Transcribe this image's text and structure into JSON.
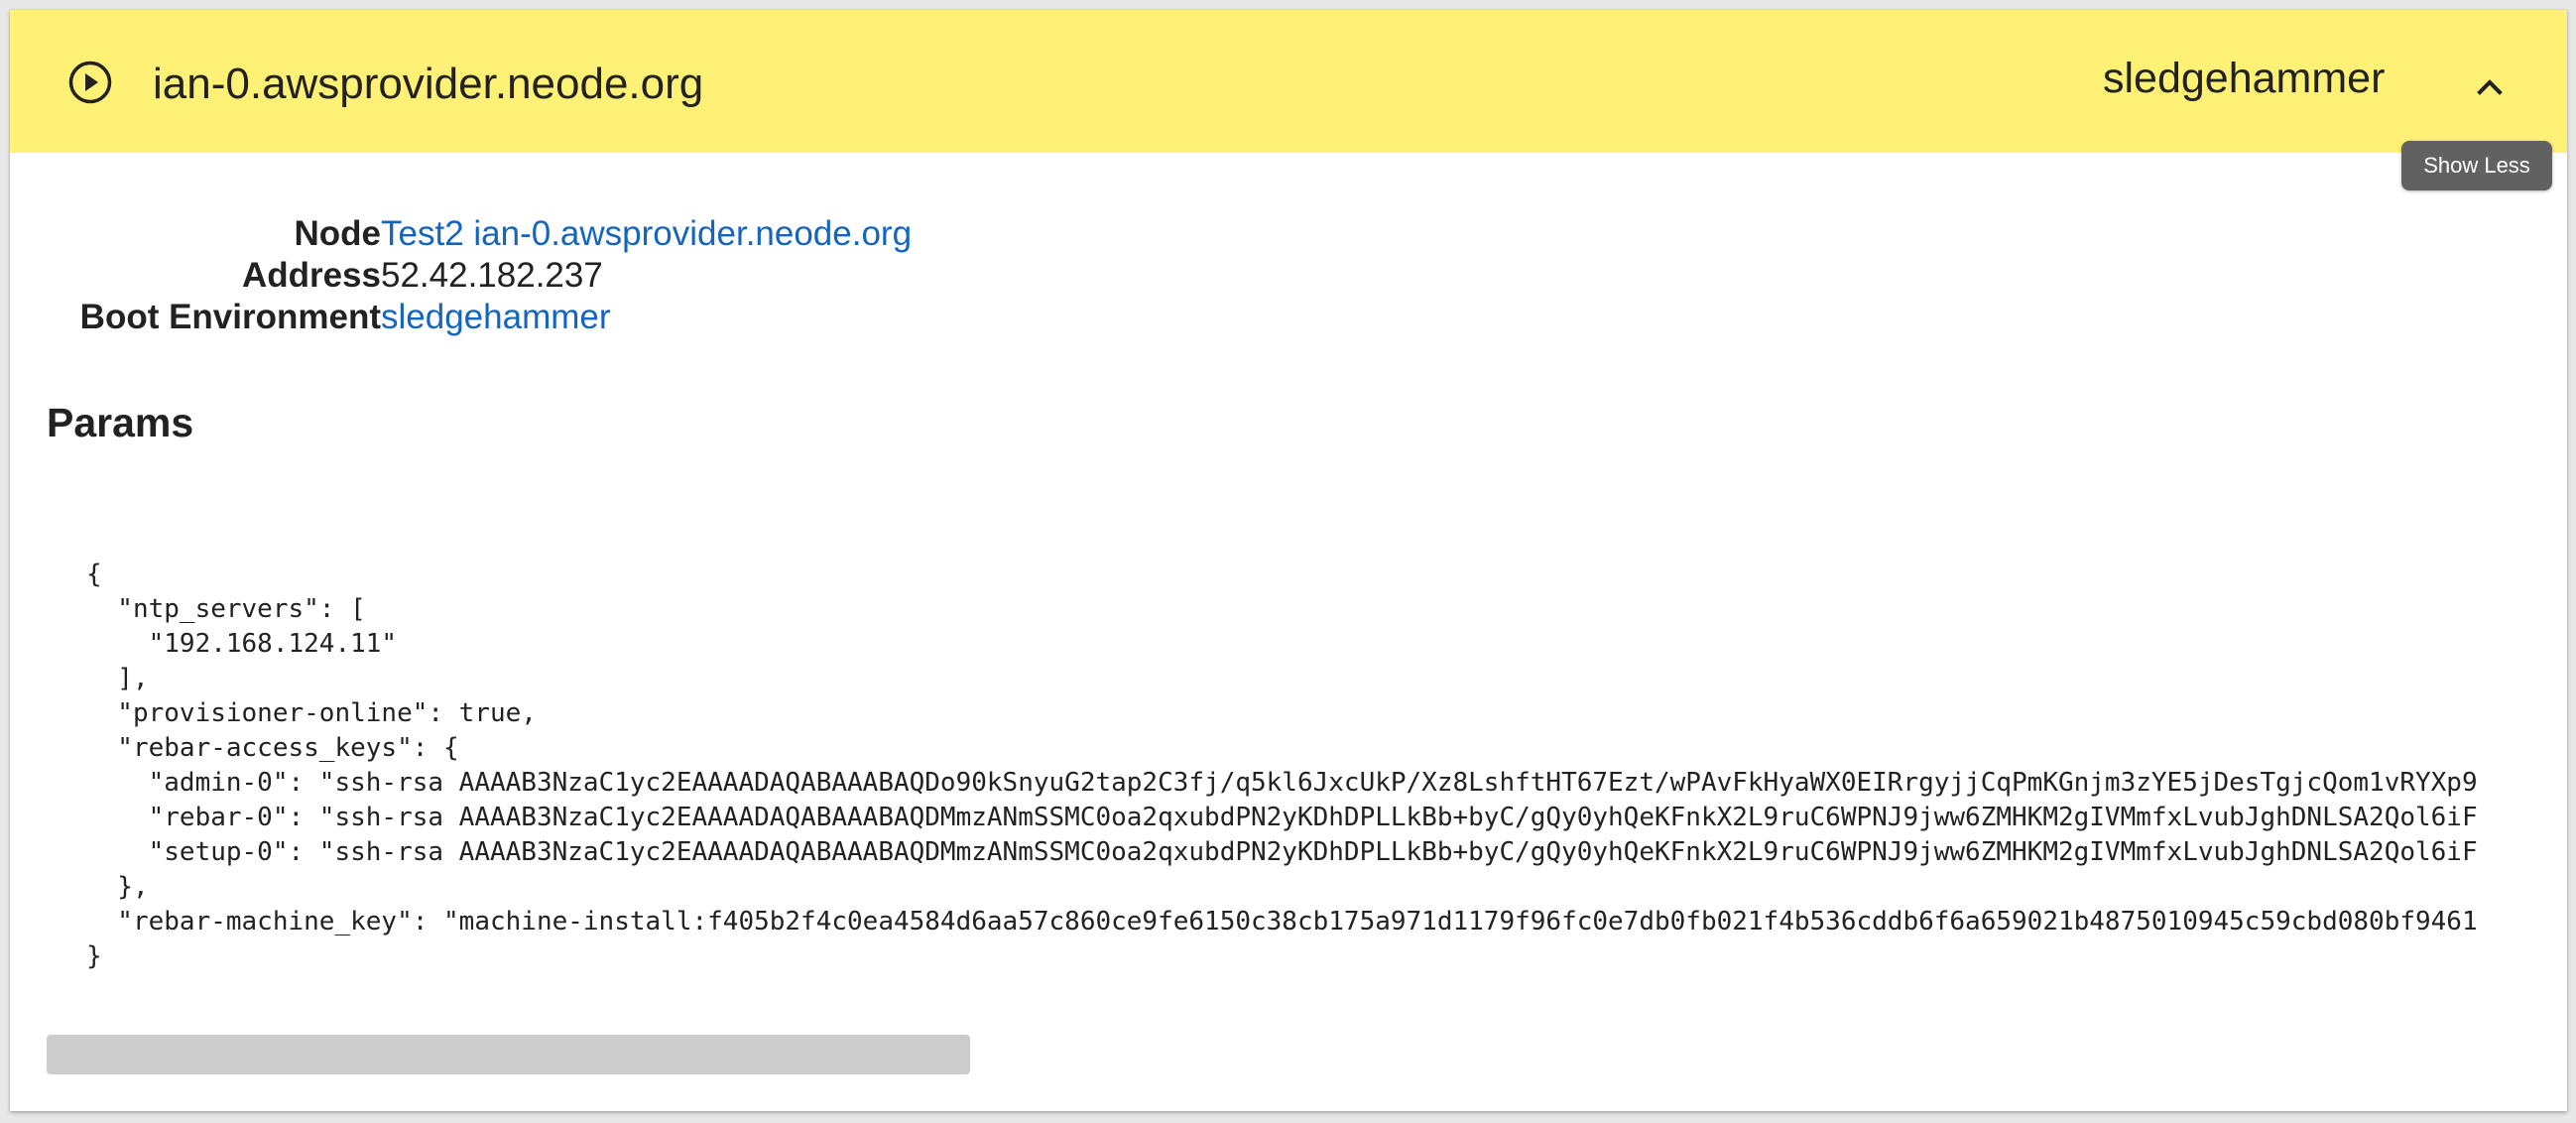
{
  "header": {
    "play_icon": "play-circle-icon",
    "machine_name": "ian-0.awsprovider.neode.org",
    "boot_env": "sledgehammer",
    "collapse_icon": "chevron-up-icon",
    "background_color": "#fff176"
  },
  "tooltip": {
    "text": "Show Less"
  },
  "details": {
    "node": {
      "label": "Node",
      "value": "Test2 ian-0.awsprovider.neode.org"
    },
    "address": {
      "label": "Address",
      "value": "52.42.182.237"
    },
    "boot_environment": {
      "label": "Boot Environment",
      "value": "sledgehammer"
    },
    "link_color": "#1565c0"
  },
  "params": {
    "title": "Params",
    "json_text": "{\n  \"ntp_servers\": [\n    \"192.168.124.11\"\n  ],\n  \"provisioner-online\": true,\n  \"rebar-access_keys\": {\n    \"admin-0\": \"ssh-rsa AAAAB3NzaC1yc2EAAAADAQABAAABAQDo90kSnyuG2tap2C3fj/q5kl6JxcUkP/Xz8LshftHT67Ezt/wPAvFkHyaWX0EIRrgyjjCqPmKGnjm3zYE5jDesTgjcQom1vRYXp9\n    \"rebar-0\": \"ssh-rsa AAAAB3NzaC1yc2EAAAADAQABAAABAQDMmzANmSSMC0oa2qxubdPN2yKDhDPLLkBb+byC/gQy0yhQeKFnkX2L9ruC6WPNJ9jww6ZMHKM2gIVMmfxLvubJghDNLSA2Qol6iF\n    \"setup-0\": \"ssh-rsa AAAAB3NzaC1yc2EAAAADAQABAAABAQDMmzANmSSMC0oa2qxubdPN2yKDhDPLLkBb+byC/gQy0yhQeKFnkX2L9ruC6WPNJ9jww6ZMHKM2gIVMmfxLvubJghDNLSA2Qol6iF\n  },\n  \"rebar-machine_key\": \"machine-install:f405b2f4c0ea4584d6aa57c860ce9fe6150c38cb175a971d1179f96fc0e7db0fb021f4b536cddb6f6a659021b4875010945c59cbd080bf9461\n}"
  },
  "scrollbar": {
    "thumb_fraction": 0.37
  }
}
